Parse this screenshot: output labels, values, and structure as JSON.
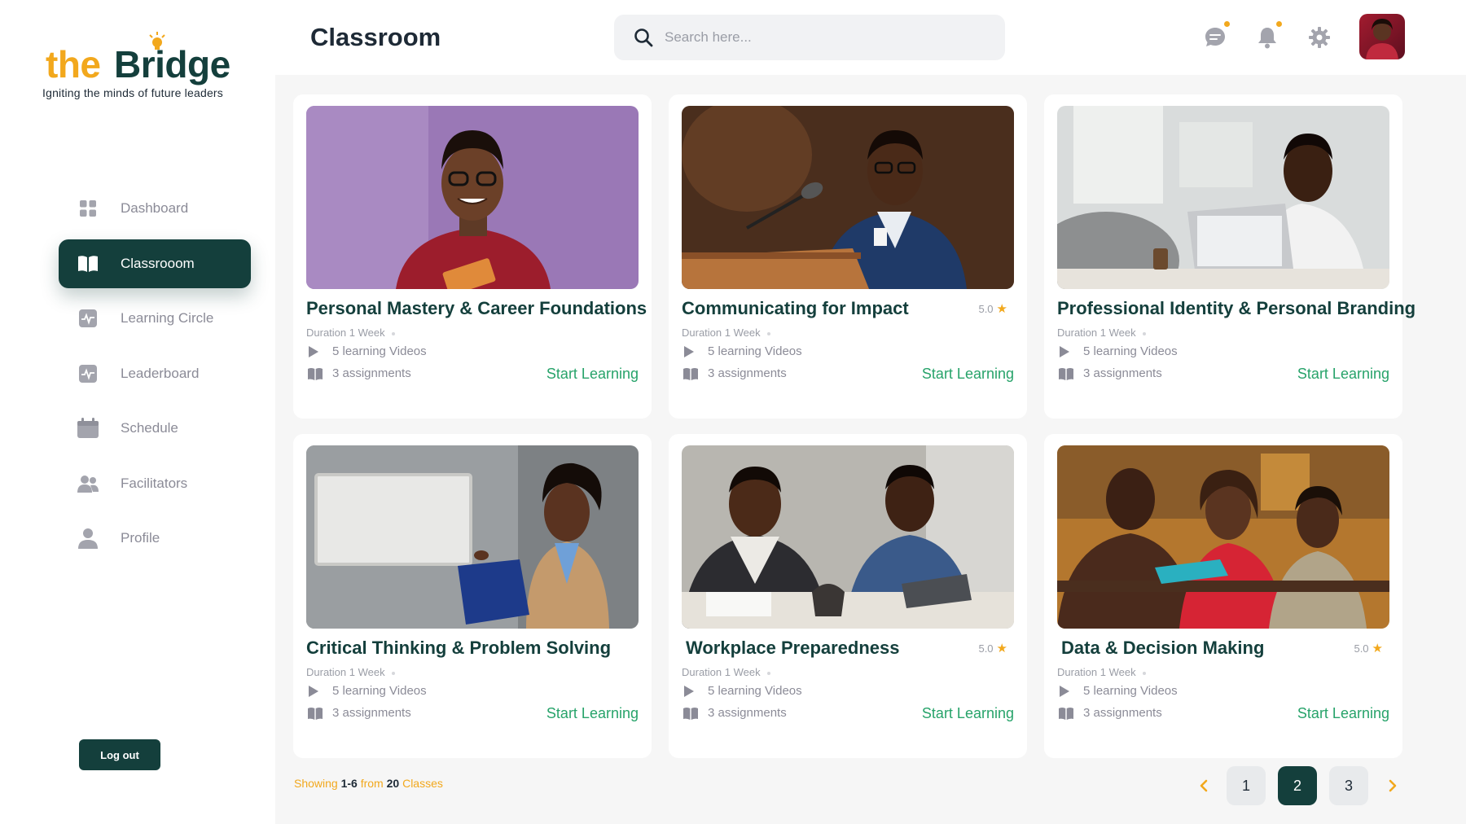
{
  "brand": {
    "word_the": "the",
    "word_bridge": "Bridge",
    "tagline": "Igniting the minds of future leaders",
    "primary_color": "#143f3c",
    "accent_color": "#f2a81d"
  },
  "header": {
    "title": "Classroom",
    "search_placeholder": "Search here...",
    "icons": [
      "chat-icon",
      "bell-icon",
      "gear-icon"
    ]
  },
  "sidebar": {
    "items": [
      {
        "label": "Dashboard",
        "icon": "grid-icon"
      },
      {
        "label": "Classrooom",
        "icon": "book-icon",
        "active": true
      },
      {
        "label": "Learning Circle",
        "icon": "activity-icon"
      },
      {
        "label": "Leaderboard",
        "icon": "activity-icon"
      },
      {
        "label": "Schedule",
        "icon": "calendar-icon"
      },
      {
        "label": "Facilitators",
        "icon": "users-icon"
      },
      {
        "label": "Profile",
        "icon": "user-icon"
      }
    ],
    "logout_label": "Log out"
  },
  "courses": [
    {
      "title": "Personal Mastery & Career Foundations",
      "rating": "",
      "duration": "Duration 1 Week",
      "videos": "5 learning Videos",
      "assignments": "3 assignments",
      "cta": "Start Learning"
    },
    {
      "title": "Communicating for Impact",
      "rating": "5.0",
      "duration": "Duration 1 Week",
      "videos": "5 learning Videos",
      "assignments": "3 assignments",
      "cta": "Start Learning"
    },
    {
      "title": "Professional Identity & Personal Branding",
      "rating": "",
      "duration": "Duration 1 Week",
      "videos": "5 learning Videos",
      "assignments": "3 assignments",
      "cta": "Start Learning"
    },
    {
      "title": "Critical Thinking & Problem Solving",
      "rating": "",
      "duration": "Duration 1 Week",
      "videos": "5 learning Videos",
      "assignments": "3 assignments",
      "cta": "Start Learning"
    },
    {
      "title": "Workplace Preparedness",
      "rating": "5.0",
      "duration": "Duration 1 Week",
      "videos": "5 learning Videos",
      "assignments": "3 assignments",
      "cta": "Start Learning"
    },
    {
      "title": "Data & Decision Making",
      "rating": "5.0",
      "duration": "Duration 1 Week",
      "videos": "5 learning Videos",
      "assignments": "3 assignments",
      "cta": "Start Learning"
    }
  ],
  "pagination": {
    "showing_prefix": "Showing",
    "range": "1-6",
    "from_word": "from",
    "total": "20",
    "suffix": "Classes",
    "pages": [
      "1",
      "2",
      "3"
    ],
    "current": "2"
  }
}
